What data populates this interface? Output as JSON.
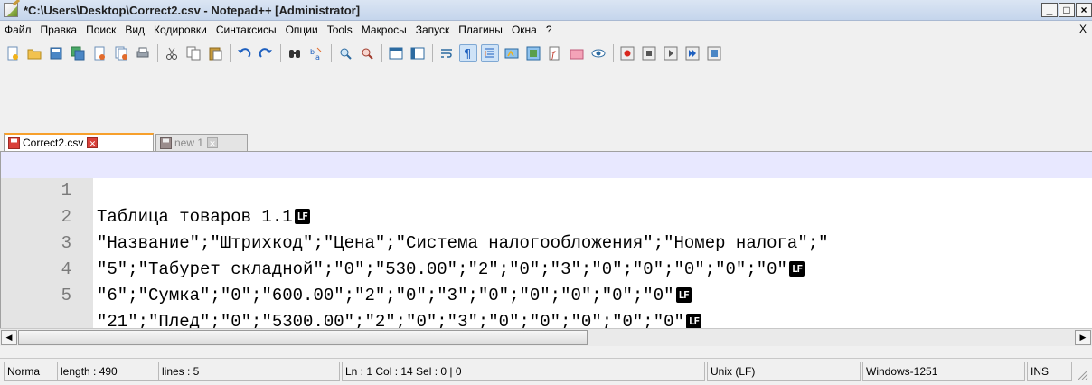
{
  "window": {
    "title": "*C:\\Users\\Desktop\\Correct2.csv - Notepad++ [Administrator]",
    "controls": {
      "minimize": "_",
      "maximize": "□",
      "close": "×"
    }
  },
  "menu": {
    "items": [
      "Файл",
      "Правка",
      "Поиск",
      "Вид",
      "Кодировки",
      "Синтаксисы",
      "Опции",
      "Tools",
      "Макросы",
      "Запуск",
      "Плагины",
      "Окна",
      "?"
    ],
    "close_label": "X"
  },
  "toolbar": {
    "icons": [
      "new-file-icon",
      "open-file-icon",
      "save-icon",
      "save-all-icon",
      "close-icon",
      "close-all-icon",
      "print-icon",
      "cut-icon",
      "copy-icon",
      "paste-icon",
      "undo-icon",
      "redo-icon",
      "find-icon",
      "replace-icon",
      "zoom-in-icon",
      "zoom-out-icon",
      "sync-vertical-icon",
      "sync-horizontal-icon",
      "word-wrap-icon",
      "show-all-chars-icon",
      "indent-guide-icon",
      "user-lang-icon",
      "doc-map-icon",
      "function-list-icon",
      "folder-workspace-icon",
      "monitoring-icon",
      "record-macro-icon",
      "stop-macro-icon",
      "play-macro-icon",
      "run-macro-multiple-icon",
      "save-macro-icon"
    ]
  },
  "tabs": [
    {
      "label": "Correct2.csv",
      "active": true
    },
    {
      "label": "new 1",
      "active": false
    }
  ],
  "editor": {
    "eol_marker": "LF",
    "lines": [
      {
        "num": "1",
        "text": "Таблица товаров 1.1",
        "eol": true
      },
      {
        "num": "2",
        "text": "\"Название\";\"Штрихкод\";\"Цена\";\"Система налогообложения\";\"Номер налога\";\"",
        "eol": false
      },
      {
        "num": "3",
        "text": "\"5\";\"Табурет складной\";\"0\";\"530.00\";\"2\";\"0\";\"3\";\"0\";\"0\";\"0\";\"0\";\"0\"",
        "eol": true
      },
      {
        "num": "4",
        "text": "\"6\";\"Сумка\";\"0\";\"600.00\";\"2\";\"0\";\"3\";\"0\";\"0\";\"0\";\"0\";\"0\"",
        "eol": true
      },
      {
        "num": "5",
        "text": "\"21\";\"Плед\";\"0\";\"5300.00\";\"2\";\"0\";\"3\";\"0\";\"0\";\"0\";\"0\";\"0\"",
        "eol": true
      }
    ],
    "current_line": 1
  },
  "statusbar": {
    "type": "Norma",
    "length": "length : 490",
    "lines": "lines : 5",
    "position": "Ln : 1   Col : 14   Sel : 0 | 0",
    "eol_format": "Unix (LF)",
    "encoding": "Windows-1251",
    "mode": "INS"
  },
  "colors": {
    "current_line": "#e8e8ff",
    "gutter": "#e4e4e4",
    "active_tab_accent": "#f7a02c",
    "save_icon_red": "#d9403a"
  }
}
